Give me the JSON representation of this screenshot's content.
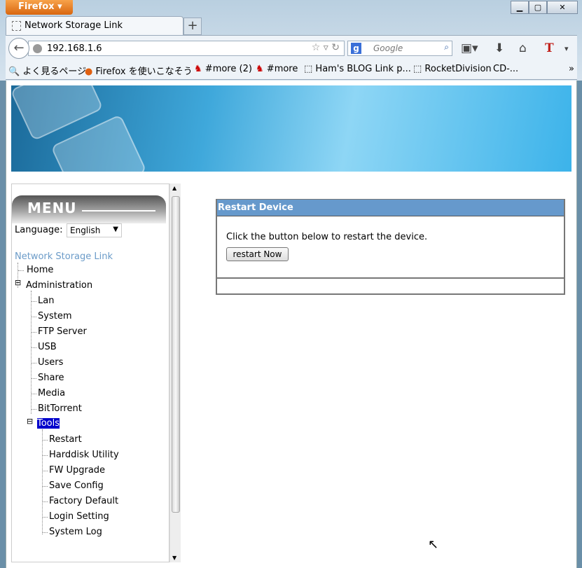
{
  "browser": {
    "menu_button": "Firefox",
    "tab_title": "Network Storage Link",
    "url": "192.168.1.6",
    "search_placeholder": "Google",
    "bookmarks": [
      "よく見るページ",
      "Firefox を使いこなそう",
      "#more (2)",
      "#more",
      "Ham's BLOG Link p...",
      "RocketDivision",
      "CD-..."
    ],
    "overflow": "»"
  },
  "menu": {
    "title": "MENU",
    "language_label": "Language:",
    "language_value": "English",
    "root": "Network Storage Link",
    "home": "Home",
    "admin": "Administration",
    "admin_items": [
      "Lan",
      "System",
      "FTP Server",
      "USB",
      "Users",
      "Share",
      "Media",
      "BitTorrent"
    ],
    "tools": "Tools",
    "tools_items": [
      "Restart",
      "Harddisk Utility",
      "FW Upgrade",
      "Save Config",
      "Factory Default",
      "Login Setting",
      "System Log"
    ]
  },
  "panel": {
    "title": "Restart Device",
    "text": "Click the button below to restart the device.",
    "button": "restart Now"
  },
  "colors": {
    "panel_header": "#6699cc",
    "selected": "#0000cc",
    "root_link": "#6b9bc8"
  }
}
